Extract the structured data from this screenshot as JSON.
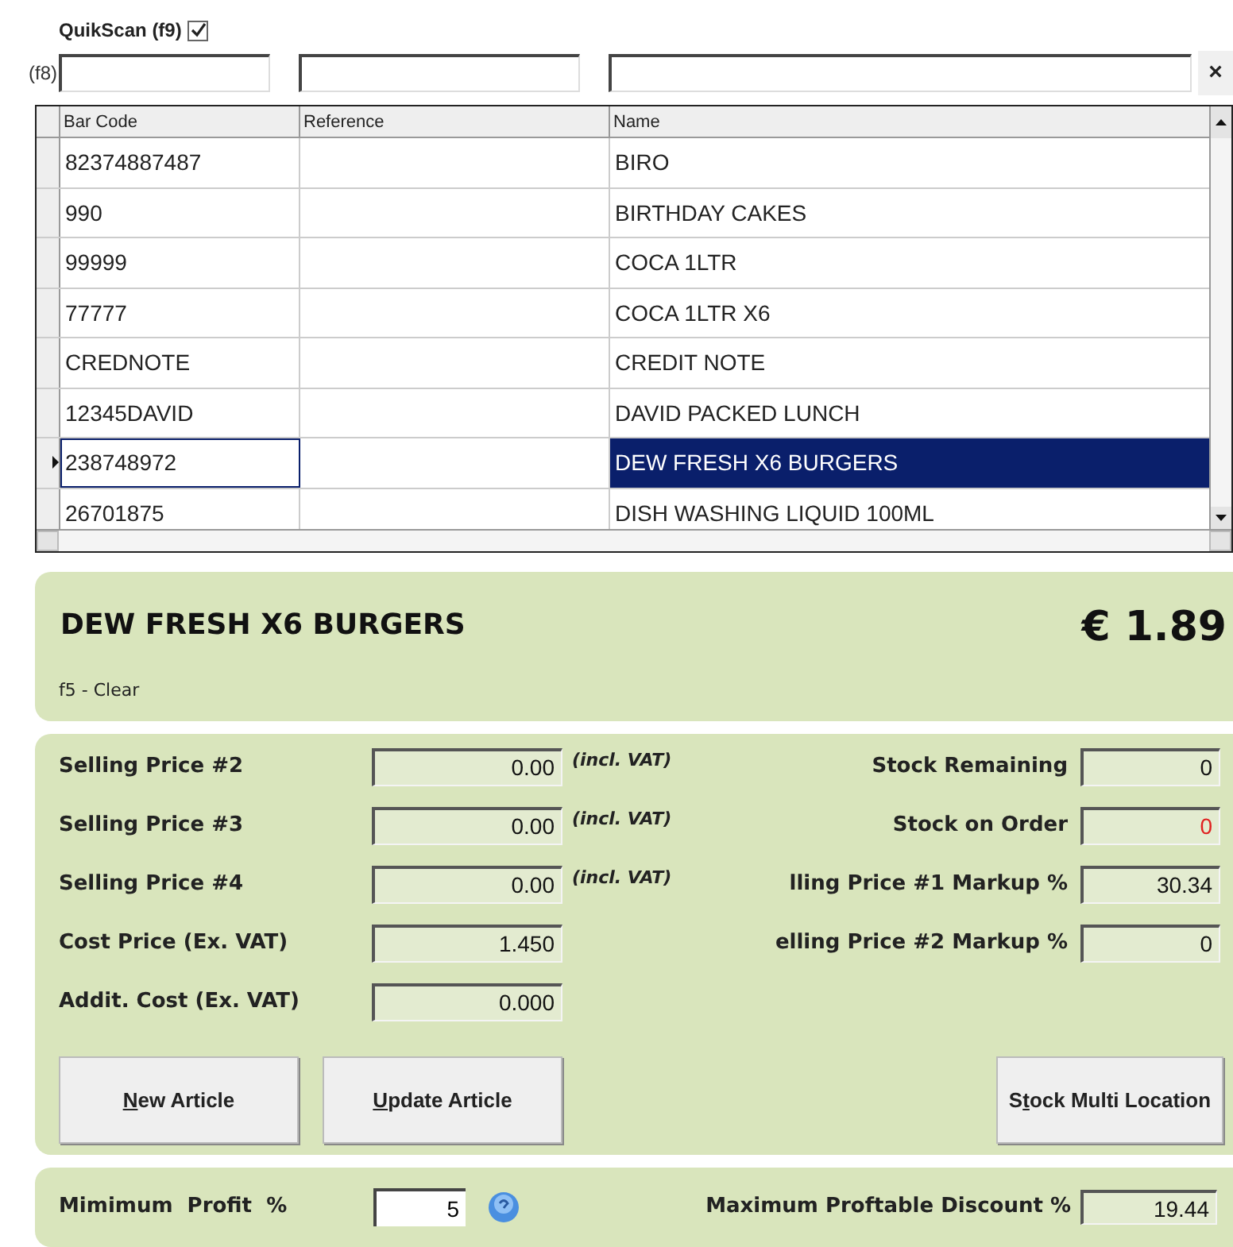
{
  "quick_scan": {
    "label": "QuikScan (f9)",
    "checked": true
  },
  "filter": {
    "shortcut": "(f8)",
    "clear": "×"
  },
  "table": {
    "columns": [
      "Bar Code",
      "Reference",
      "Name"
    ],
    "rows": [
      {
        "bar_code": "82374887487",
        "name": "BIRO",
        "selected": false
      },
      {
        "bar_code": "990",
        "name": "BIRTHDAY CAKES",
        "selected": false
      },
      {
        "bar_code": "99999",
        "name": "COCA 1LTR",
        "selected": false
      },
      {
        "bar_code": "77777",
        "name": "COCA 1LTR X6",
        "selected": false
      },
      {
        "bar_code": "CREDNOTE",
        "name": "CREDIT NOTE",
        "selected": false
      },
      {
        "bar_code": "12345DAVID",
        "name": "DAVID PACKED LUNCH",
        "selected": false
      },
      {
        "bar_code": "238748972",
        "name": "DEW FRESH X6 BURGERS",
        "selected": true
      },
      {
        "bar_code": "26701875",
        "name": "DISH WASHING LIQUID 100ML",
        "selected": false
      }
    ]
  },
  "article": {
    "name": "DEW FRESH X6 BURGERS",
    "price": "€ 1.89",
    "hint": "f5 - Clear"
  },
  "left_fields": [
    {
      "label": "Selling Price #2",
      "value": "0.00",
      "note": "(incl. VAT)"
    },
    {
      "label": "Selling Price #3",
      "value": "0.00",
      "note": "(incl. VAT)"
    },
    {
      "label": "Selling Price #4",
      "value": "0.00",
      "note": "(incl. VAT)"
    },
    {
      "label": "Cost Price (Ex. VAT)",
      "value": "1.450"
    },
    {
      "label": "Addit. Cost (Ex. VAT)",
      "value": "0.000"
    }
  ],
  "right_fields": [
    {
      "label": "Stock Remaining",
      "value": "0",
      "alert": false
    },
    {
      "label": "Stock on Order",
      "value": "0",
      "alert": true
    },
    {
      "label": "lling Price #1 Markup %",
      "value": "30.34",
      "alert": false
    },
    {
      "label": "elling Price #2 Markup %",
      "value": "0",
      "alert": false
    }
  ],
  "buttons": [
    {
      "key": "N",
      "rest": "ew Article"
    },
    {
      "key": "U",
      "rest": "pdate Article"
    },
    {
      "lead": "S",
      "key": "t",
      "rest": "ock Multi Location"
    }
  ],
  "profit": {
    "label": "Mimimum  Profit  %",
    "value": "5"
  },
  "discount": {
    "label": "Maximum Proftable Discount %",
    "value": "19.44"
  }
}
